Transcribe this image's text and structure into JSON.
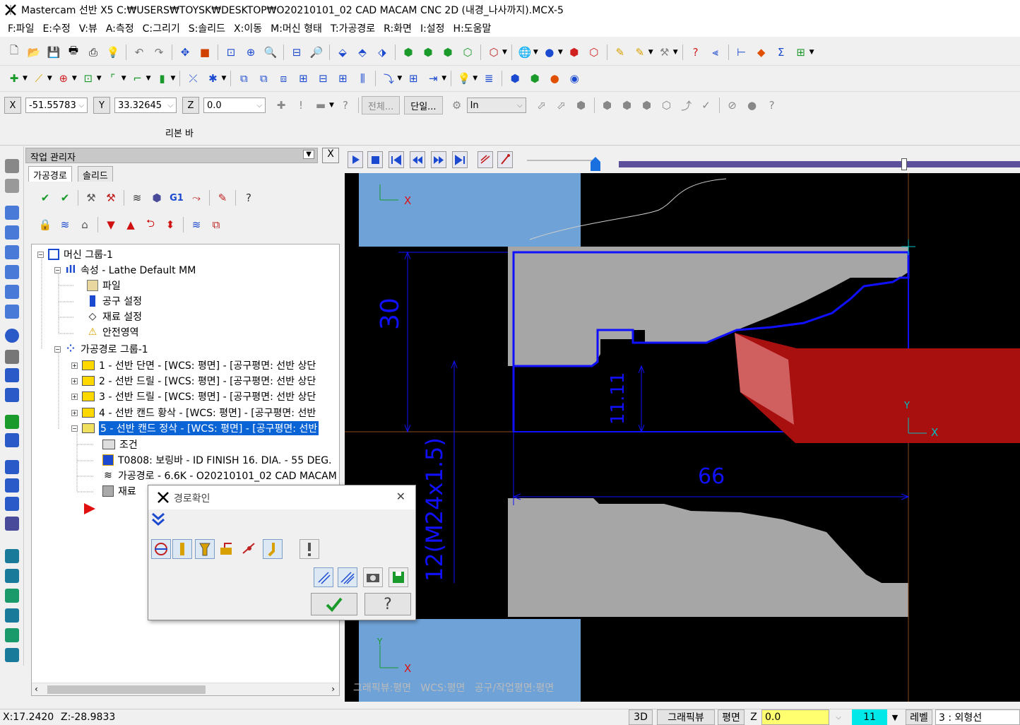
{
  "window": {
    "title": "Mastercam 선반 X5  C:₩USERS₩TOYSK₩DESKTOP₩O20210101_02 CAD MACAM CNC 2D (내경_나사까지).MCX-5"
  },
  "menu": [
    "F:파일",
    "E:수정",
    "V:뷰",
    "A:측정",
    "C:그리기",
    "S:솔리드",
    "X:이동",
    "M:머신 형태",
    "T:가공경로",
    "R:화면",
    "I:설정",
    "H:도움말"
  ],
  "coords": {
    "x_label": "X",
    "x_value": "-51.55783",
    "y_label": "Y",
    "y_value": "33.32645",
    "z_label": "Z",
    "z_value": "0.0",
    "all_btn": "전체...",
    "single_btn": "단일...",
    "unit_value": "In"
  },
  "ribbon": {
    "label": "리본 바"
  },
  "manager": {
    "title": "작업 관리자",
    "close": "X",
    "tabs": [
      "가공경로",
      "솔리드"
    ],
    "tree": {
      "machine_group": "머신 그룹-1",
      "properties": "속성 - Lathe Default MM",
      "files": "파일",
      "tool_setup": "공구 설정",
      "stock_setup": "재료 설정",
      "safety_zone": "안전영역",
      "toolpath_group": "가공경로 그룹-1",
      "ops": [
        "1 - 선반 단면 - [WCS: 평면] - [공구평면: 선반 상단",
        "2 - 선반 드릴 - [WCS: 평면] - [공구평면: 선반 상단",
        "3 - 선반 드릴 - [WCS: 평면] - [공구평면: 선반 상단",
        "4 - 선반 캔드 황삭 - [WCS: 평면] - [공구평면: 선반",
        "5 - 선반 캔드 정삭 - [WCS: 평면] - [공구평면: 선반"
      ],
      "op5_children": [
        "조건",
        "T0808: 보링바 - ID FINISH 16. DIA. - 55 DEG.",
        "가공경로 - 6.6K - O20210101_02 CAD MACAM",
        "재료"
      ]
    }
  },
  "dialog": {
    "title": "경로확인",
    "close": "✕"
  },
  "graphics": {
    "dim_30": "30",
    "dim_11": "11.11",
    "dim_66": "66",
    "dim_thread": "12(M24x1.5)",
    "axis_x": "X",
    "axis_y": "Y",
    "footer": "그래픽뷰:평면   WCS:평면   공구/작업평면:평면"
  },
  "status": {
    "x": "X:17.2420",
    "z": "Z:-28.9833",
    "view3d": "3D",
    "gview": "그래픽뷰",
    "plane": "평면",
    "z_label": "Z",
    "z_value": "0.0",
    "level_num": "11",
    "level_label": "레벨",
    "level_value": "3 : 외형선"
  },
  "colors": {
    "stock": "#6fa3d8",
    "part": "#a6a6a6",
    "boundary": "#1010ff",
    "tool": "#c41818",
    "highlight": "#0a64d6"
  }
}
